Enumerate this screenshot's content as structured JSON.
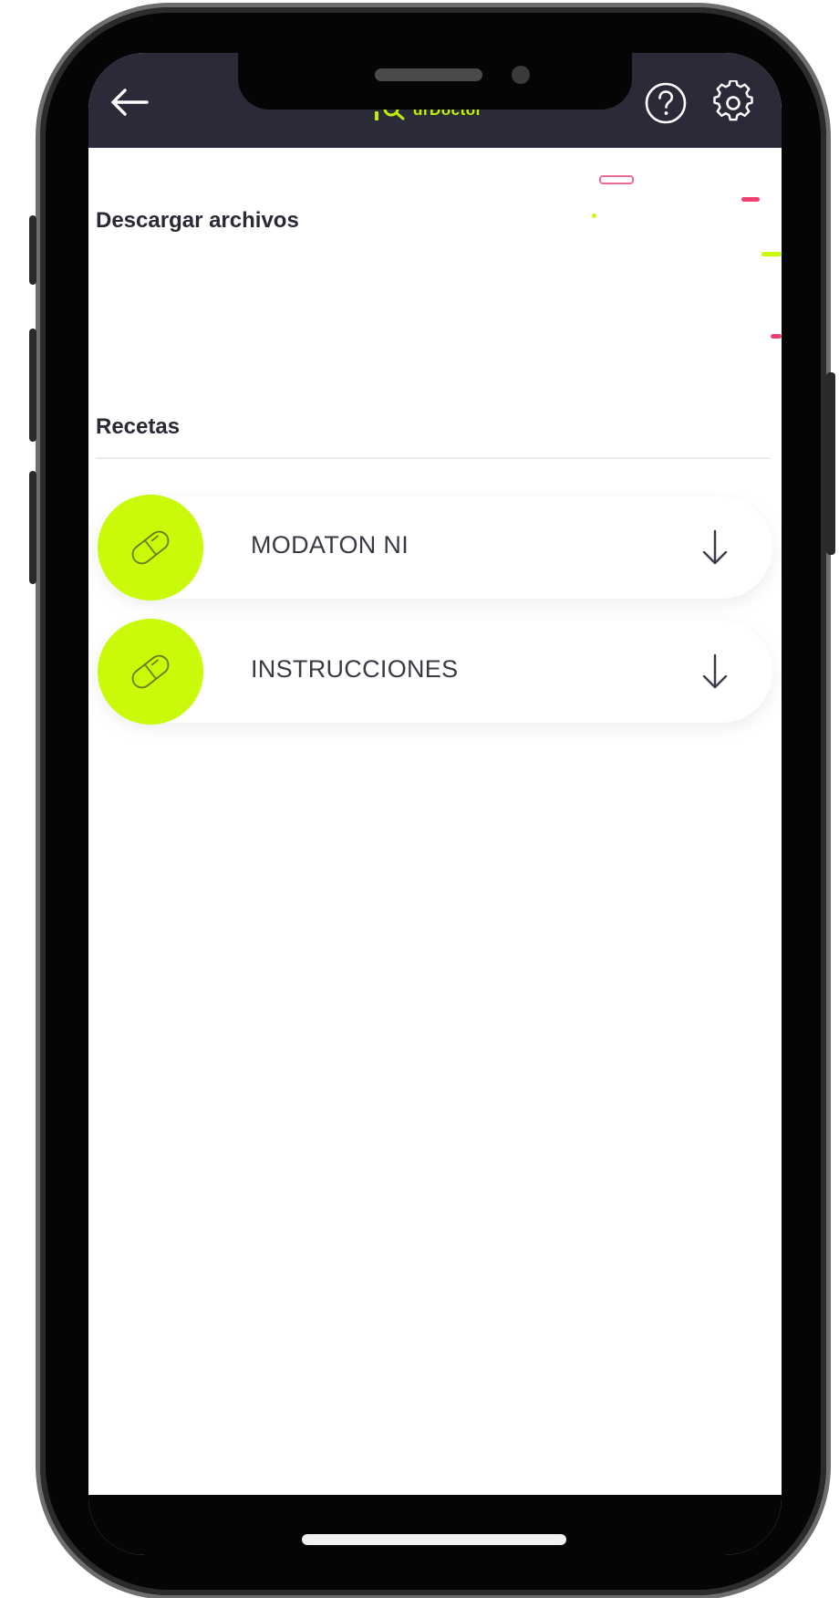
{
  "header": {
    "logo_text": "drDoctor",
    "back_icon": "arrow-left-icon",
    "help_icon": "question-circle-icon",
    "settings_icon": "gear-icon"
  },
  "sections": {
    "download_title": "Descargar archivos",
    "recipes_title": "Recetas"
  },
  "files": [
    {
      "label": "MODATON NI",
      "icon": "pill-icon",
      "action_icon": "arrow-down-icon"
    },
    {
      "label": "INSTRUCCIONES",
      "icon": "pill-icon",
      "action_icon": "arrow-down-icon"
    }
  ],
  "colors": {
    "header_bg": "#2a2a38",
    "accent": "#c8fa0a",
    "accent_text": "#c4f000",
    "decor_pink": "#f04070",
    "text_dark": "#2a2a35"
  }
}
